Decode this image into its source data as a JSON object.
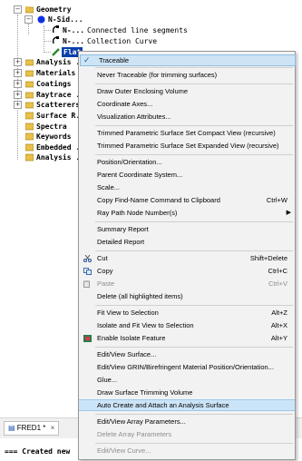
{
  "tree": {
    "items": [
      {
        "label": "Geometry",
        "toggle": "−"
      },
      {
        "label": "N-Sid...",
        "toggle": "−"
      },
      {
        "label": "N-..."
      },
      {
        "label": "N-..."
      },
      {
        "label": "Flat"
      },
      {
        "label": "Analysis ...",
        "toggle": "+"
      },
      {
        "label": "Materials",
        "toggle": "+"
      },
      {
        "label": "Coatings",
        "toggle": "+"
      },
      {
        "label": "Raytrace ...",
        "toggle": "+"
      },
      {
        "label": "Scatterers",
        "toggle": "+"
      },
      {
        "label": "Surface R..."
      },
      {
        "label": "Spectra"
      },
      {
        "label": "Keywords"
      },
      {
        "label": "Embedded ..."
      },
      {
        "label": "Analysis ..."
      }
    ],
    "descriptions": [
      "Connected line segments",
      "Collection Curve"
    ]
  },
  "bottom": {
    "tab_label": "FRED1 *",
    "output_text": "=== Created new"
  },
  "menu": {
    "items": [
      {
        "label": "Traceable",
        "checked": true
      },
      {
        "label": "Never Traceable (for trimming surfaces)"
      },
      {
        "label": "Draw Outer Enclosing Volume"
      },
      {
        "label": "Coordinate Axes..."
      },
      {
        "label": "Visualization Attributes..."
      },
      {
        "label": "Trimmed Parametric Surface Set Compact View (recursive)"
      },
      {
        "label": "Trimmed Parametric Surface Set Expanded View (recursive)"
      },
      {
        "label": "Position/Orientation..."
      },
      {
        "label": "Parent Coordinate System..."
      },
      {
        "label": "Scale..."
      },
      {
        "label": "Copy Find-Name Command to Clipboard",
        "shortcut": "Ctrl+W"
      },
      {
        "label": "Ray Path Node Number(s)"
      },
      {
        "label": "Summary Report"
      },
      {
        "label": "Detailed Report"
      },
      {
        "label": "Cut",
        "shortcut": "Shift+Delete"
      },
      {
        "label": "Copy",
        "shortcut": "Ctrl+C"
      },
      {
        "label": "Paste",
        "shortcut": "Ctrl+V"
      },
      {
        "label": "Delete (all highlighted items)"
      },
      {
        "label": "Fit View to Selection",
        "shortcut": "Alt+Z"
      },
      {
        "label": "Isolate and Fit View to Selection",
        "shortcut": "Alt+X"
      },
      {
        "label": "Enable Isolate Feature",
        "shortcut": "Alt+Y"
      },
      {
        "label": "Edit/View Surface..."
      },
      {
        "label": "Edit/View GRIN/Birefringent Material Position/Orientation..."
      },
      {
        "label": "Glue..."
      },
      {
        "label": "Draw Surface Trimming Volume"
      },
      {
        "label": "Auto Create and Attach an Analysis Surface"
      },
      {
        "label": "Edit/View Array Parameters..."
      },
      {
        "label": "Delete Array Parameters"
      },
      {
        "label": "Edit/View Curve..."
      }
    ]
  }
}
